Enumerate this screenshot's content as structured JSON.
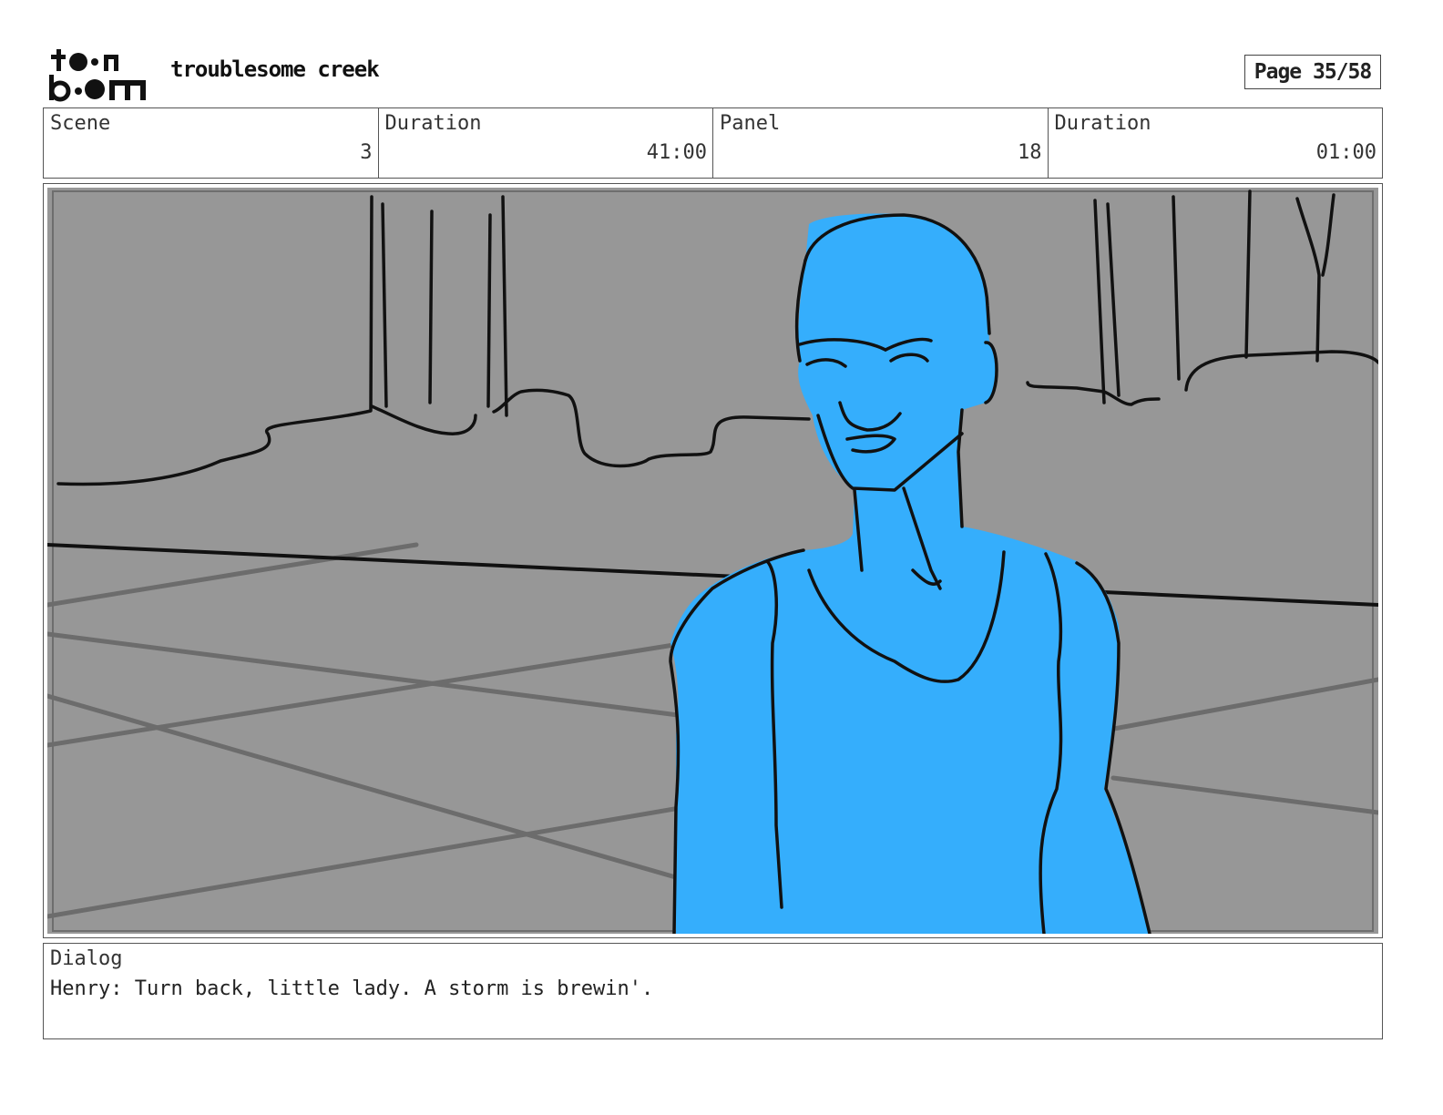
{
  "header": {
    "logo_text": "toon boom",
    "project_title": "troublesome creek",
    "page_label": "Page 35/58"
  },
  "info": {
    "scene_label": "Scene",
    "scene_value": "3",
    "scene_duration_label": "Duration",
    "scene_duration_value": "41:00",
    "panel_label": "Panel",
    "panel_value": "18",
    "panel_duration_label": "Duration",
    "panel_duration_value": "01:00"
  },
  "dialog": {
    "label": "Dialog",
    "text": "Henry: Turn back, little lady. A storm is brewin'."
  },
  "colors": {
    "background_gray": "#979797",
    "character_blue": "#35aefc",
    "ink": "#111111"
  }
}
